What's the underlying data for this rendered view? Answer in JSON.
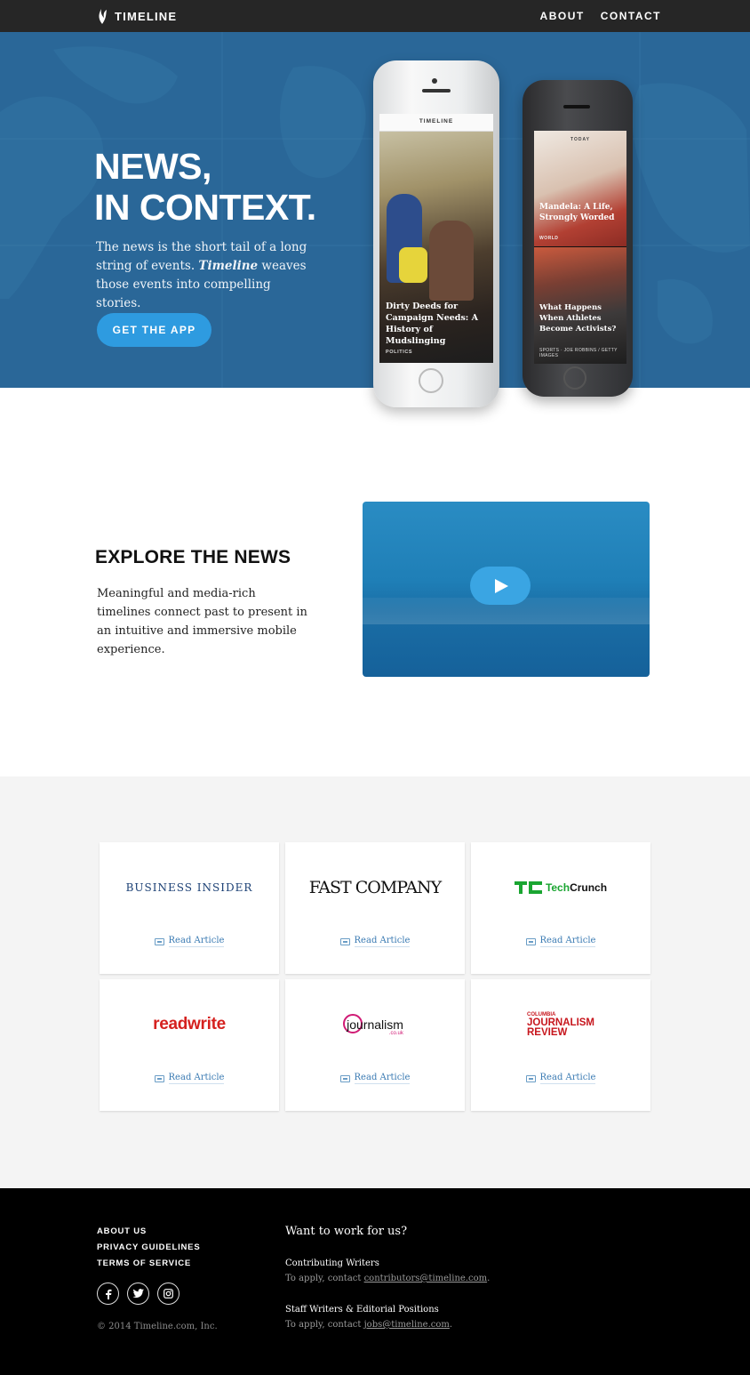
{
  "nav": {
    "brand": "TIMELINE",
    "links": [
      "ABOUT",
      "CONTACT"
    ]
  },
  "hero": {
    "headline_line1": "NEWS,",
    "headline_line2": "IN CONTEXT.",
    "desc_before": "The news is the short tail of a long string of events. ",
    "desc_em": "Timeline",
    "desc_after": " weaves those events into compelling stories.",
    "cta": "GET THE APP",
    "phone_white": {
      "header": "TIMELINE",
      "story_title": "Dirty Deeds for Campaign Needs: A History of Mudslinging",
      "story_tag": "POLITICS"
    },
    "phone_black": {
      "header": "TODAY",
      "story1_title": "Mandela: A Life, Strongly Worded",
      "story1_tag": "WORLD",
      "story2_title": "What Happens When Athletes Become Activists?",
      "story2_tag": "SPORTS · JOE ROBBINS / GETTY IMAGES"
    }
  },
  "explore": {
    "heading": "EXPLORE THE NEWS",
    "body": "Meaningful and media-rich timelines connect past to present in an intuitive and immersive mobile experience."
  },
  "press": {
    "read_label": "Read Article",
    "outlets": [
      {
        "name": "BUSINESS INSIDER"
      },
      {
        "name": "FAST COMPANY",
        "display": "FAST COMPANY"
      },
      {
        "name": "TechCrunch",
        "part1": "Tech",
        "part2": "Crunch"
      },
      {
        "name": "readwrite"
      },
      {
        "name": "journalism",
        "suffix": ".co.uk"
      },
      {
        "name": "COLUMBIA JOURNALISM REVIEW",
        "small": "COLUMBIA",
        "l1": "JOURNALISM",
        "l2": "REVIEW"
      }
    ]
  },
  "footer": {
    "links": [
      "ABOUT US",
      "PRIVACY GUIDELINES",
      "TERMS OF SERVICE"
    ],
    "social_icons": [
      "facebook-icon",
      "twitter-icon",
      "instagram-icon"
    ],
    "copyright": "© 2014 Timeline.com, Inc.",
    "work_heading": "Want to work for us?",
    "jobs": [
      {
        "title": "Contributing Writers",
        "apply_text": "To apply, contact ",
        "email": "contributors@timeline.com"
      },
      {
        "title": "Staff Writers & Editorial Positions",
        "apply_text": "To apply, contact ",
        "email": "jobs@timeline.com"
      }
    ]
  },
  "colors": {
    "nav_bg": "#262626",
    "hero_bg": "#2a6798",
    "cta_bg": "#2e9be0",
    "press_bg": "#f4f4f4",
    "footer_bg": "#000000",
    "link": "#3b7bb3"
  }
}
